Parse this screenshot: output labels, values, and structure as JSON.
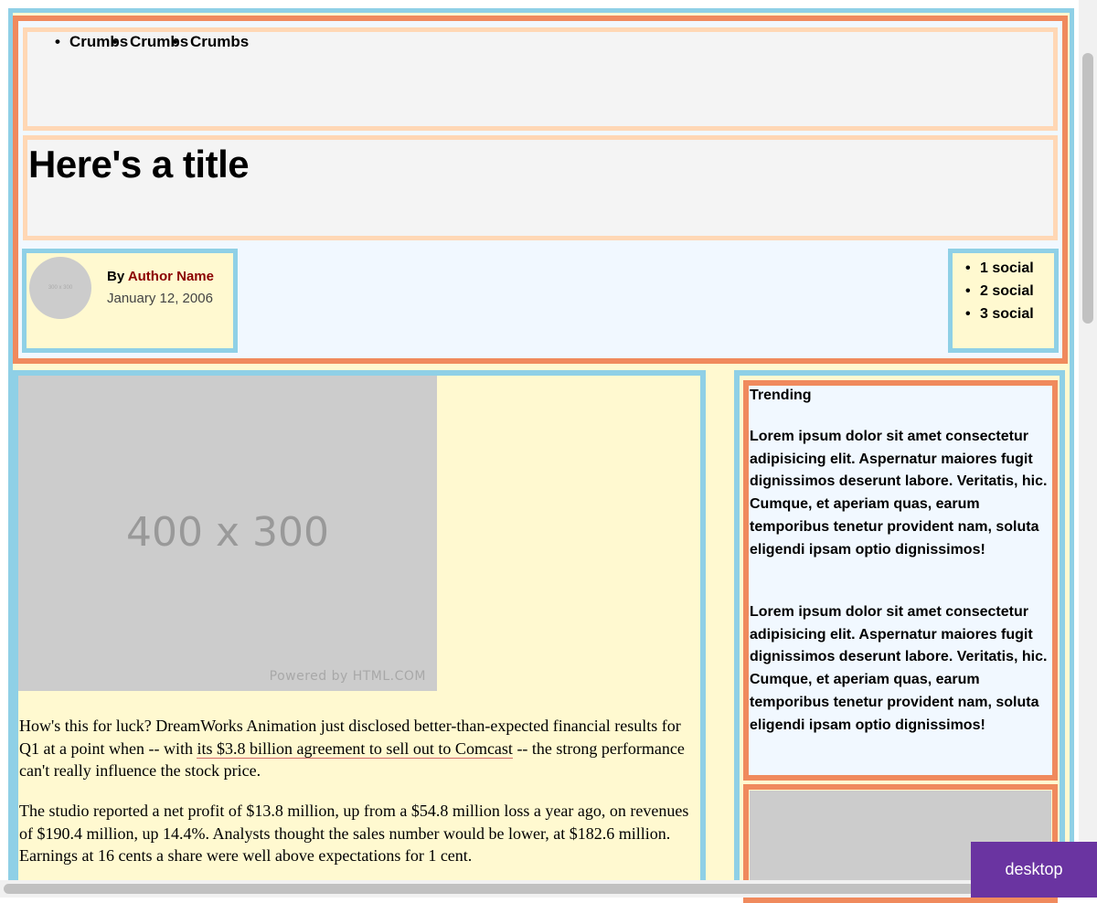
{
  "header": {
    "breadcrumbs": [
      "Crumbs",
      "Crumbs",
      "Crumbs"
    ],
    "title": "Here's a title",
    "author": {
      "by_label": "By",
      "name": "Author Name",
      "date": "January 12, 2006",
      "avatar_text": "300 x 300"
    },
    "social": [
      "1 social",
      "2 social",
      "3 social"
    ]
  },
  "article": {
    "image": {
      "label": "400 x 300",
      "caption": "Powered by HTML.COM"
    },
    "p1_before": "How's this for luck? DreamWorks Animation just disclosed better-than-expected financial results for Q1 at a point when -- with ",
    "p1_link": "its $3.8 billion agreement to sell out to Comcast",
    "p1_after": " -- the strong performance can't really influence the stock price.",
    "p2": "The studio reported a net profit of $13.8 million, up from a $54.8 million loss a year ago, on revenues of $190.4 million, up 14.4%. Analysts thought the sales number would be lower, at $182.6 million. Earnings at 16 cents a share were well above expectations for 1 cent."
  },
  "sidebar": {
    "trending_title": "Trending",
    "paragraphs": [
      "Lorem ipsum dolor sit amet consectetur adipisicing elit. Aspernatur maiores fugit dignissimos deserunt labore. Veritatis, hic. Cumque, et aperiam quas, earum temporibus tenetur provident nam, soluta eligendi ipsam optio dignissimos!",
      "Lorem ipsum dolor sit amet consectetur adipisicing elit. Aspernatur maiores fugit dignissimos deserunt labore. Veritatis, hic. Cumque, et aperiam quas, earum temporibus tenetur provident nam, soluta eligendi ipsam optio dignissimos!"
    ]
  },
  "badge": "desktop",
  "colors": {
    "frame_blue": "#8fd0e6",
    "frame_orange": "#f08a5d",
    "frame_peach": "#ffd7b5",
    "fill_yellow": "#fff9d0",
    "fill_blue": "#f1f8ff",
    "author_link": "#8b0000",
    "badge_purple": "#6a34a1"
  }
}
